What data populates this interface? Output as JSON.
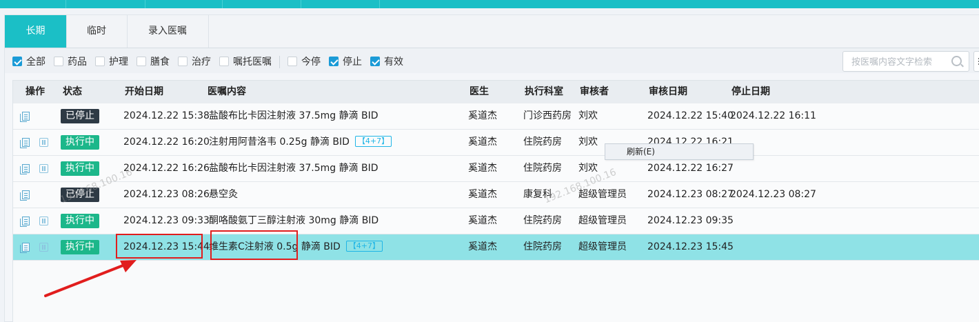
{
  "top_bar": {
    "accent_color": "#1bbfc6"
  },
  "tabs": [
    {
      "label": "长期",
      "active": true
    },
    {
      "label": "临时",
      "active": false
    },
    {
      "label": "录入医嘱",
      "active": false
    }
  ],
  "filters": [
    {
      "label": "全部",
      "checked": true
    },
    {
      "label": "药品",
      "checked": false
    },
    {
      "label": "护理",
      "checked": false
    },
    {
      "label": "膳食",
      "checked": false
    },
    {
      "label": "治疗",
      "checked": false
    },
    {
      "label": "嘱托医嘱",
      "checked": false
    },
    {
      "label": "今停",
      "checked": false
    },
    {
      "label": "停止",
      "checked": true
    },
    {
      "label": "有效",
      "checked": true
    }
  ],
  "search": {
    "placeholder": "按医嘱内容文字检索",
    "value": ""
  },
  "table": {
    "columns": [
      "操作",
      "状态",
      "开始日期",
      "医嘱内容",
      "医生",
      "执行科室",
      "审核者",
      "审核日期",
      "停止日期"
    ],
    "rows": [
      {
        "status": "已停止",
        "status_type": "stopped",
        "start": "2024.12.22 15:38",
        "content": "盐酸布比卡因注射液 37.5mg 静滴 BID",
        "badge": "",
        "doctor": "奚道杰",
        "dept": "门诊西药房",
        "reviewer": "刘欢",
        "review_date": "2024.12.22 15:40",
        "stop_date": "2024.12.22 16:11",
        "pause_icon": false,
        "selected": false
      },
      {
        "status": "执行中",
        "status_type": "running",
        "start": "2024.12.22 16:20",
        "content": "注射用阿昔洛韦 0.25g 静滴 BID",
        "badge": "【4+7】",
        "doctor": "奚道杰",
        "dept": "住院药房",
        "reviewer": "刘欢",
        "review_date": "2024.12.22 16:21",
        "stop_date": "",
        "pause_icon": true,
        "selected": false
      },
      {
        "status": "执行中",
        "status_type": "running",
        "start": "2024.12.22 16:26",
        "content": "盐酸布比卡因注射液 37.5mg 静滴 BID",
        "badge": "",
        "doctor": "奚道杰",
        "dept": "住院药房",
        "reviewer": "刘欢",
        "review_date": "2024.12.22 16:27",
        "stop_date": "",
        "pause_icon": true,
        "selected": false
      },
      {
        "status": "已停止",
        "status_type": "stopped",
        "start": "2024.12.23 08:26",
        "content": "悬空灸",
        "badge": "",
        "doctor": "奚道杰",
        "dept": "康复科",
        "reviewer": "超级管理员",
        "review_date": "2024.12.23 08:27",
        "stop_date": "2024.12.23 08:27",
        "pause_icon": false,
        "selected": false
      },
      {
        "status": "执行中",
        "status_type": "running",
        "start": "2024.12.23 09:33",
        "content": "酮咯酸氨丁三醇注射液 30mg 静滴 BID",
        "badge": "",
        "doctor": "奚道杰",
        "dept": "住院药房",
        "reviewer": "超级管理员",
        "review_date": "2024.12.23 09:35",
        "stop_date": "",
        "pause_icon": true,
        "selected": false
      },
      {
        "status": "执行中",
        "status_type": "running",
        "start": "2024.12.23 15:44",
        "content": "维生素C注射液 0.5g 静滴 BID",
        "badge": "【4+7】",
        "doctor": "奚道杰",
        "dept": "住院药房",
        "reviewer": "超级管理员",
        "review_date": "2024.12.23 15:45",
        "stop_date": "",
        "pause_icon": true,
        "selected": true
      }
    ]
  },
  "context_menu": {
    "item": "刷新(E)"
  },
  "watermarks": [
    "192.168.100.16",
    "192.168.100.16"
  ],
  "colors": {
    "accent": "#1bbfc6",
    "checkbox": "#1b9bd7",
    "status_running": "#1cb78a",
    "status_stopped": "#2e3a45",
    "selected_row": "#8fe2e6",
    "annotation_red": "#e11d1d"
  }
}
